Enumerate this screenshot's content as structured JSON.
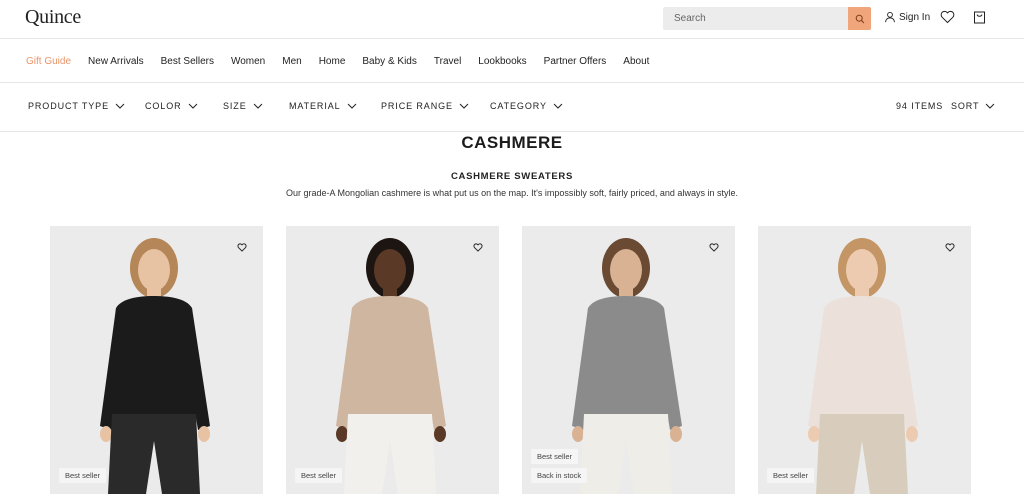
{
  "header": {
    "logo": "Quince",
    "search_placeholder": "Search",
    "sign_in_label": "Sign In",
    "icons": [
      "search-icon",
      "user-icon",
      "heart-icon",
      "bag-icon"
    ],
    "accent_color": "#f0a57a"
  },
  "nav": {
    "items": [
      {
        "label": "Gift Guide",
        "active": true
      },
      {
        "label": "New Arrivals"
      },
      {
        "label": "Best Sellers"
      },
      {
        "label": "Women"
      },
      {
        "label": "Men"
      },
      {
        "label": "Home"
      },
      {
        "label": "Baby & Kids"
      },
      {
        "label": "Travel"
      },
      {
        "label": "Lookbooks"
      },
      {
        "label": "Partner Offers"
      },
      {
        "label": "About"
      }
    ],
    "active_color": "#e8956a"
  },
  "filters": {
    "items": [
      "PRODUCT TYPE",
      "COLOR",
      "SIZE",
      "MATERIAL",
      "PRICE RANGE",
      "CATEGORY"
    ],
    "items_count": "94 ITEMS",
    "sort_label": "SORT"
  },
  "page": {
    "title": "CASHMERE",
    "section_title": "CASHMERE SWEATERS",
    "description": "Our grade-A Mongolian cashmere is what put us on the map. It's impossibly soft, fairly priced, and always in style."
  },
  "products": [
    {
      "badges": [
        "Best seller"
      ],
      "sweater_color": "#1b1b1b",
      "pants_color": "#2a2a2a",
      "hair_color": "#b58658",
      "skin_color": "#e7c3a4"
    },
    {
      "badges": [
        "Best seller"
      ],
      "sweater_color": "#cfb6a0",
      "pants_color": "#f1f0ec",
      "hair_color": "#1d1512",
      "skin_color": "#5a3a26"
    },
    {
      "badges": [
        "Best seller",
        "Back in stock"
      ],
      "sweater_color": "#8b8b8b",
      "pants_color": "#efede8",
      "hair_color": "#6a4a33",
      "skin_color": "#d9b193"
    },
    {
      "badges": [
        "Best seller"
      ],
      "sweater_color": "#ebe1da",
      "pants_color": "#d8cdbd",
      "hair_color": "#c49565",
      "skin_color": "#eccbb1"
    }
  ]
}
